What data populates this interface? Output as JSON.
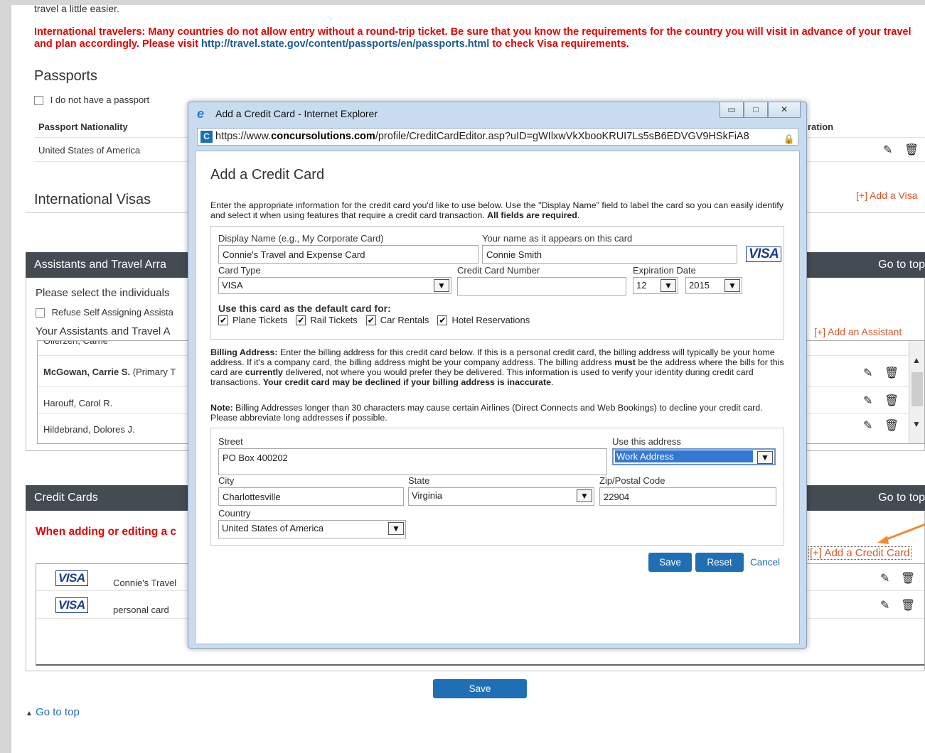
{
  "page": {
    "intro_tail": "travel a little easier.",
    "intl_note": "International travelers: Many countries do not allow entry without a round-trip ticket. Be sure that you know the requirements for the country you will visit in advance of your travel and plan accordingly. Please visit",
    "intl_link": "http://travel.state.gov/content/passports/en/passports.html",
    "intl_note_end": "to check Visa requirements.",
    "passports": {
      "title": "Passports",
      "no_passport_label": "I do not have a passport",
      "col_nationality": "Passport Nationality",
      "col_expiration_partial": "ration",
      "row_nationality": "United States of America"
    },
    "visas": {
      "title": "International Visas",
      "add_link": "[+] Add a Visa"
    },
    "assistants": {
      "title": "Assistants and Travel Arra",
      "go_to_top": "Go to top",
      "select_text": "Please select the individuals",
      "refuse_label": "Refuse Self Assigning Assista",
      "list_title": "Your Assistants and Travel A",
      "add_link": "[+] Add an Assistant",
      "rows": [
        "Ollerzen, Carrie",
        "McGowan, Carrie S.",
        "Harouff, Carol R.",
        "Hildebrand, Dolores J."
      ],
      "primary_tag": "(Primary T"
    },
    "credit_cards": {
      "title": "Credit Cards",
      "go_to_top": "Go to top",
      "note": "When adding or editing a c",
      "add_link": "[+] Add a Credit Card",
      "rows": [
        {
          "brand": "VISA",
          "name": "Connie's Travel"
        },
        {
          "brand": "VISA",
          "name": "personal card"
        }
      ]
    },
    "save_label": "Save",
    "go_to_top": "Go to top"
  },
  "dialog": {
    "window_title": "Add a Credit Card - Internet Explorer",
    "url_prefix": "https://www.",
    "url_domain": "concursolutions.com",
    "url_rest": "/profile/CreditCardEditor.asp?uID=gWIlxwVkXbooKRUI7Ls5sB6EDVGV9HSkFiA8",
    "heading": "Add a Credit Card",
    "intro": "Enter the appropriate information for the credit card you'd like to use below. Use the \"Display Name\" field to label the card so you can easily identify and select it when using features that require a credit card transaction.",
    "intro_bold": "All fields are required",
    "display_name_label": "Display Name (e.g., My Corporate Card)",
    "display_name_value": "Connie's Travel and Expense Card",
    "cardholder_label": "Your name as it appears on this card",
    "cardholder_value": "Connie Smith",
    "brand_logo": "VISA",
    "card_type_label": "Card Type",
    "card_type_value": "VISA",
    "card_number_label": "Credit Card Number",
    "card_number_value": "",
    "expiration_label": "Expiration Date",
    "exp_month": "12",
    "exp_year": "2015",
    "default_for_label": "Use this card as the default card for:",
    "default_options": [
      "Plane Tickets",
      "Rail Tickets",
      "Car Rentals",
      "Hotel Reservations"
    ],
    "billing_bold": "Billing Address:",
    "billing_text_1": "Enter the billing address for this credit card below. If this is a personal credit card, the billing address will typically be your home address. If it's a company card, the billing address might be your company address. The billing address",
    "billing_must": "must",
    "billing_text_2": "be the address where the bills for this card are",
    "billing_currently": "currently",
    "billing_text_3": "delivered, not where you would prefer they be delivered. This information is used to verify your identity during credit card transactions.",
    "billing_warning": "Your credit card may be declined if your billing address is inaccurate",
    "note_bold": "Note:",
    "note_text": "Billing Addresses longer than 30 characters may cause certain Airlines (Direct Connects and Web Bookings) to decline your credit card. Please abbreviate long addresses if possible.",
    "street_label": "Street",
    "street_value": "PO Box 400202",
    "use_address_label": "Use this address",
    "use_address_value": "Work Address",
    "city_label": "City",
    "city_value": "Charlottesville",
    "state_label": "State",
    "state_value": "Virginia",
    "zip_label": "Zip/Postal Code",
    "zip_value": "22904",
    "country_label": "Country",
    "country_value": "United States of America",
    "save_label": "Save",
    "reset_label": "Reset",
    "cancel_label": "Cancel"
  }
}
